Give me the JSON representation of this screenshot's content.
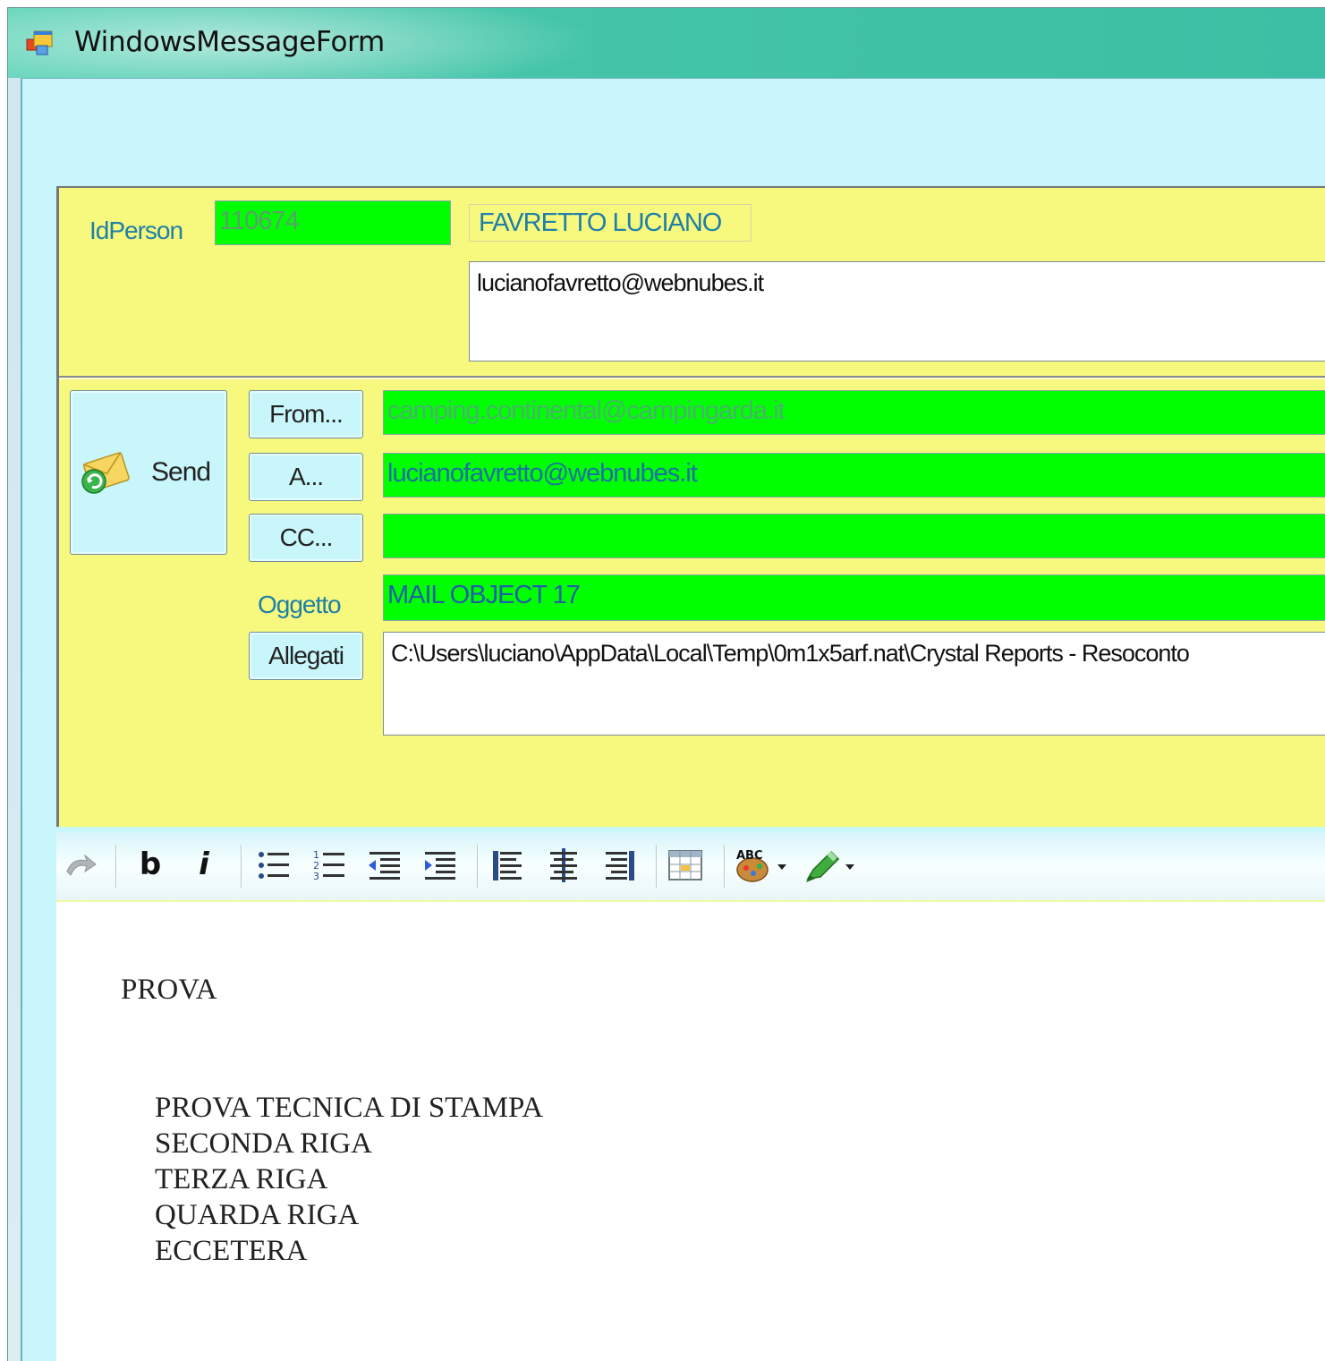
{
  "window": {
    "title": "WindowsMessageForm",
    "accent_color": "#44c5a8",
    "client_color": "#c9f6fb",
    "panel_color": "#f7f97e",
    "field_color": "#00ff00"
  },
  "person": {
    "id_label": "IdPerson",
    "id_value": "110674",
    "name": "FAVRETTO LUCIANO",
    "email_box": "lucianofavretto@webnubes.it"
  },
  "mail": {
    "send_label": "Send",
    "send_icon": "send-mail-icon",
    "from_button": "From...",
    "from_value": "camping.continental@campingarda.it",
    "to_button": "A...",
    "to_value": "lucianofavretto@webnubes.it",
    "cc_button": "CC...",
    "cc_value": "",
    "subject_label": "Oggetto",
    "subject_value": "MAIL OBJECT 17",
    "attach_button": "Allegati",
    "attach_value": "C:\\Users\\luciano\\AppData\\Local\\Temp\\0m1x5arf.nat\\Crystal Reports - Resoconto"
  },
  "toolbar": {
    "items": [
      "undo-icon",
      "bold-icon",
      "italic-icon",
      "bulleted-list-icon",
      "numbered-list-icon",
      "outdent-icon",
      "indent-icon",
      "align-left-icon",
      "align-center-icon",
      "align-right-icon",
      "insert-table-icon",
      "spellcheck-icon",
      "highlight-icon"
    ],
    "bold_label": "b",
    "italic_label": "i"
  },
  "body": {
    "heading": "PROVA",
    "lines": [
      "PROVA TECNICA DI STAMPA",
      "SECONDA RIGA",
      "TERZA RIGA",
      "QUARDA RIGA",
      "ECCETERA"
    ]
  }
}
